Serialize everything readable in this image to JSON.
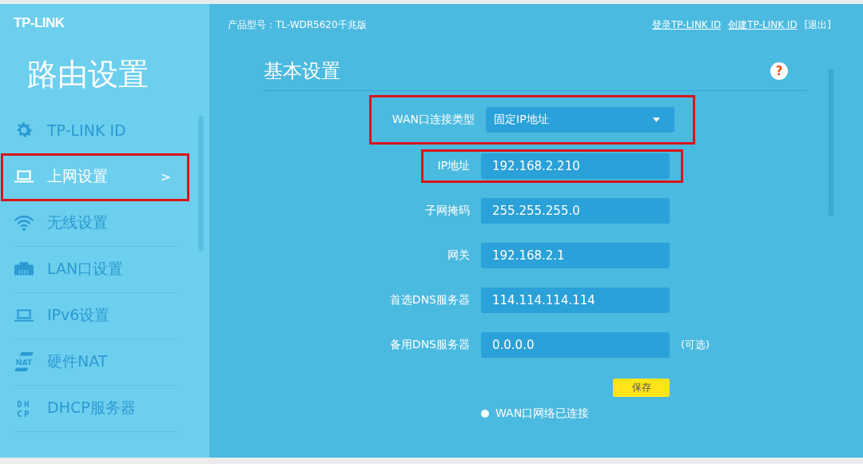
{
  "brand": {
    "logo": "TP-LINK",
    "title": "路由设置"
  },
  "sidebar": {
    "items": [
      {
        "label": "TP-LINK ID",
        "kind": "gear",
        "selected": false,
        "highlighted": false
      },
      {
        "label": "上网设置",
        "kind": "laptop",
        "selected": true,
        "highlighted": true,
        "chevron": ">"
      },
      {
        "label": "无线设置",
        "kind": "wifi",
        "selected": false,
        "highlighted": false
      },
      {
        "label": "LAN口设置",
        "kind": "lan",
        "selected": false,
        "highlighted": false
      },
      {
        "label": "IPv6设置",
        "kind": "laptop",
        "selected": false,
        "highlighted": false
      },
      {
        "label": "硬件NAT",
        "kind": "nat",
        "icon_text": "NAT",
        "selected": false,
        "highlighted": false
      },
      {
        "label": "DHCP服务器",
        "kind": "dhcp",
        "icon_text": "DHCP",
        "selected": false,
        "highlighted": false
      }
    ]
  },
  "header": {
    "product": "产品型号：TL-WDR5620千兆版",
    "links": [
      "登录TP-LINK ID",
      "创建TP-LINK ID"
    ],
    "logout": "[退出]"
  },
  "section": {
    "title": "基本设置",
    "help": "?"
  },
  "fields": [
    {
      "kind": "select",
      "label": "WAN口连接类型",
      "value": "固定IP地址",
      "highlighted": true
    },
    {
      "kind": "text",
      "label": "IP地址",
      "value": "192.168.2.210",
      "highlighted": true
    },
    {
      "kind": "text",
      "label": "子网掩码",
      "value": "255.255.255.0",
      "highlighted": false
    },
    {
      "kind": "text",
      "label": "网关",
      "value": "192.168.2.1",
      "highlighted": false
    },
    {
      "kind": "text",
      "label": "首选DNS服务器",
      "value": "114.114.114.114",
      "highlighted": false
    },
    {
      "kind": "text",
      "label": "备用DNS服务器",
      "value": "0.0.0.0",
      "note": "(可选)",
      "highlighted": false
    }
  ],
  "save_button": "保存",
  "status": "WAN口网络已连接"
}
